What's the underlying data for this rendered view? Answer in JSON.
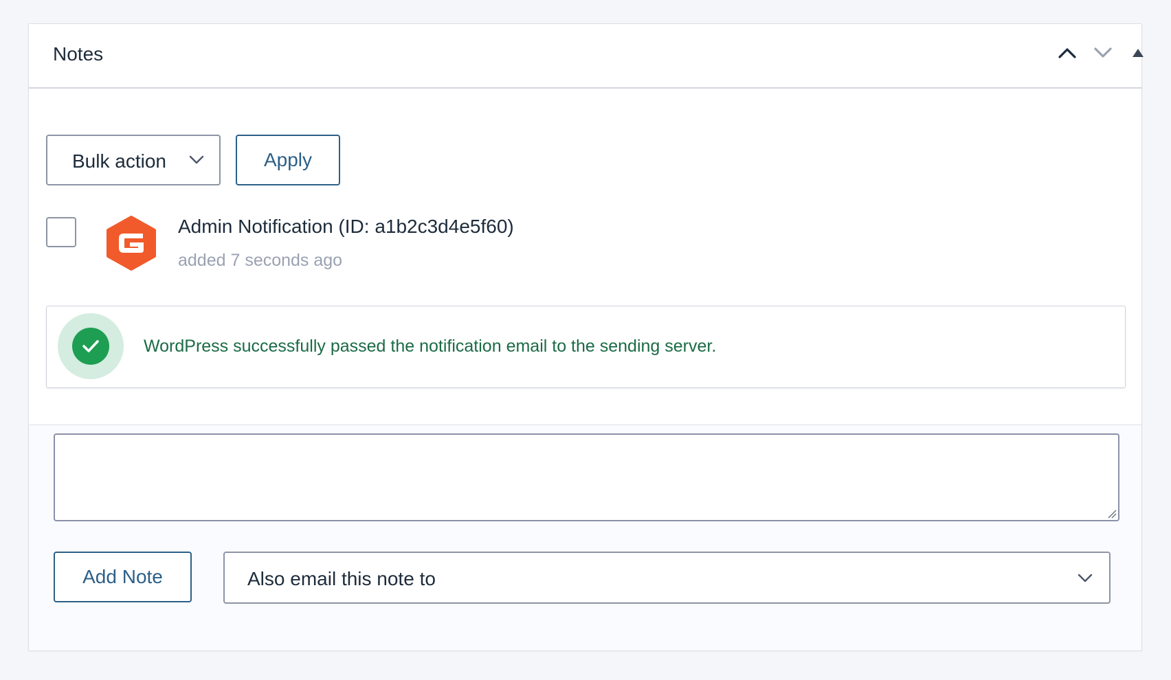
{
  "panel": {
    "title": "Notes",
    "controls": {
      "move_up_icon": "chevron-up-icon",
      "move_down_icon": "chevron-down-icon",
      "toggle_icon": "triangle-up-icon"
    }
  },
  "toolbar": {
    "bulk_action_label": "Bulk action",
    "apply_label": "Apply"
  },
  "notes": [
    {
      "avatar_icon": "gravity-forms-logo-icon",
      "title": "Admin Notification (ID: a1b2c3d4e5f60)",
      "time": "added 7 seconds ago",
      "checked": false,
      "status_icon": "check-circle-icon",
      "message": "WordPress successfully passed the notification email to the sending server."
    }
  ],
  "composer": {
    "textarea_value": "",
    "add_note_label": "Add Note",
    "email_select_label": "Also email this note to"
  },
  "colors": {
    "accent": "#2c5f87",
    "success": "#1e9e52",
    "success_text": "#1b6b45",
    "brand_orange": "#f15a2b"
  }
}
